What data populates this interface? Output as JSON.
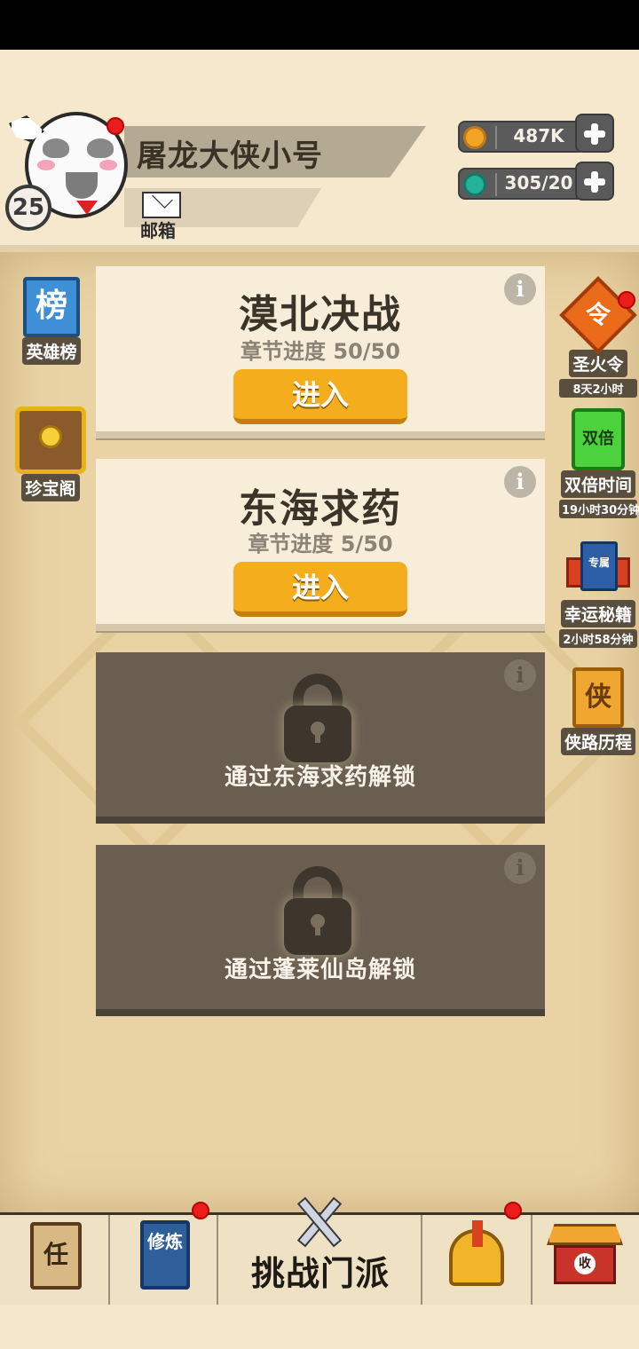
{
  "profile": {
    "name": "屠龙大侠小号",
    "level": "25",
    "mail_label": "邮箱"
  },
  "currencies": [
    {
      "icon": "copper-coin-icon",
      "value": "487K",
      "color": "#f2a524"
    },
    {
      "icon": "jade-gem-icon",
      "value": "305/20",
      "color": "#23b39a"
    }
  ],
  "left_sidebar": [
    {
      "icon": "ranking-banner-icon",
      "icon_text": "榜",
      "label": "英雄榜"
    },
    {
      "icon": "treasure-chest-icon",
      "label": "珍宝阁"
    }
  ],
  "right_sidebar": [
    {
      "icon": "sacred-fire-token-icon",
      "icon_text": "令",
      "label": "圣火令",
      "sub": "8天2小时"
    },
    {
      "icon": "double-card-icon",
      "icon_text": "双倍",
      "label": "双倍时间",
      "sub": "19小时30分钟"
    },
    {
      "icon": "exclusive-book-icon",
      "icon_text": "专属",
      "label": "幸运秘籍",
      "sub": "2小时58分钟"
    },
    {
      "icon": "hero-path-icon",
      "icon_text": "侠",
      "label": "侠路历程"
    }
  ],
  "chapters": [
    {
      "title": "漠北决战",
      "progress": "章节进度 50/50",
      "button": "进入",
      "locked": false
    },
    {
      "title": "东海求药",
      "progress": "章节进度 5/50",
      "button": "进入",
      "locked": false
    },
    {
      "unlock_text": "通过东海求药解锁",
      "locked": true
    },
    {
      "unlock_text": "通过蓬莱仙岛解锁",
      "locked": true
    }
  ],
  "info_glyph": "i",
  "bottom_nav": {
    "task_icon_text": "任",
    "cultivate_icon_text": "修炼",
    "challenge_label": "挑战门派",
    "collect_icon_text": "收"
  },
  "colors": {
    "enter_button": "#f4ad1c",
    "card_light": "#f8edd9",
    "card_locked": "#6a5e50",
    "notification_dot": "#ea1d1d"
  }
}
